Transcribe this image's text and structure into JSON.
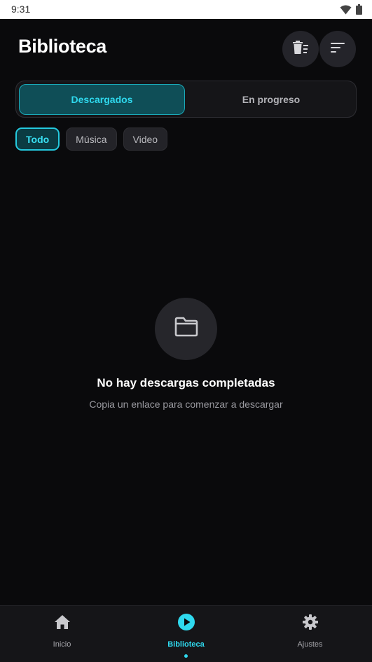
{
  "status_bar": {
    "time": "9:31",
    "icons": [
      "wifi-icon",
      "battery-icon"
    ]
  },
  "header": {
    "title": "Biblioteca",
    "actions": [
      {
        "icon": "delete-list-icon"
      },
      {
        "icon": "sort-icon"
      }
    ]
  },
  "tabs": {
    "items": [
      {
        "label": "Descargados",
        "active": true
      },
      {
        "label": "En progreso",
        "active": false
      }
    ]
  },
  "filters": {
    "items": [
      {
        "label": "Todo",
        "active": true
      },
      {
        "label": "Música",
        "active": false
      },
      {
        "label": "Video",
        "active": false
      }
    ]
  },
  "empty_state": {
    "icon": "folder-icon",
    "title": "No hay descargas completadas",
    "subtitle": "Copia un enlace para comenzar a descargar"
  },
  "bottom_nav": {
    "items": [
      {
        "label": "Inicio",
        "icon": "home-icon",
        "active": false
      },
      {
        "label": "Biblioteca",
        "icon": "play-circle-icon",
        "active": true
      },
      {
        "label": "Ajustes",
        "icon": "gear-icon",
        "active": false
      }
    ]
  },
  "colors": {
    "background": "#0a0a0c",
    "accent": "#2fd9ee",
    "surface": "#24242a"
  }
}
